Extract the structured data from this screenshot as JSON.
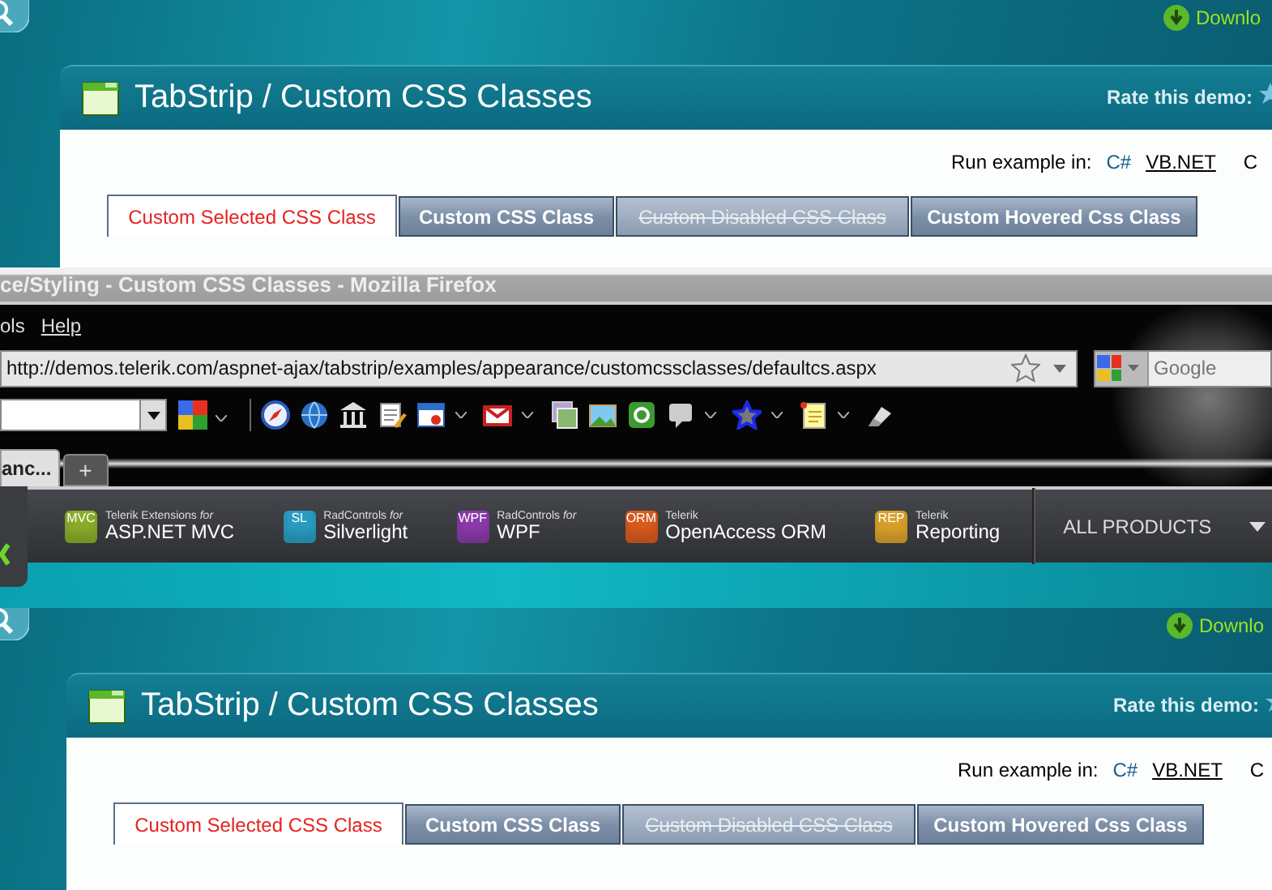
{
  "top_demo": {
    "download": "Downlo",
    "title": "TabStrip / Custom CSS Classes",
    "rate_label": "Rate this demo:",
    "run_label": "Run example in:",
    "languages": [
      {
        "label": "C#",
        "selected": true
      },
      {
        "label": "VB.NET",
        "selected": false
      }
    ],
    "edge_text": "C",
    "tabs": [
      {
        "label": "Custom Selected CSS Class",
        "selected": true,
        "disabled": false
      },
      {
        "label": "Custom CSS Class",
        "selected": false,
        "disabled": false
      },
      {
        "label": "Custom Disabled CSS Class",
        "selected": false,
        "disabled": true
      },
      {
        "label": "Custom Hovered Css Class",
        "selected": false,
        "disabled": false
      }
    ]
  },
  "firefox": {
    "title": "ce/Styling - Custom CSS Classes - Mozilla Firefox",
    "menu": [
      "ols",
      "Help"
    ],
    "url": "http://demos.telerik.com/aspnet-ajax/tabstrip/examples/appearance/customcssclasses/defaultcs.aspx",
    "search_placeholder": "Google",
    "tab_label": "anc...",
    "new_tab": "+"
  },
  "product_bar": {
    "items": [
      {
        "badge": "MVC",
        "tagline": "Telerik Extensions *for*",
        "name": "ASP.NET MVC",
        "color": "#8aac2a"
      },
      {
        "badge": "SL",
        "tagline": "RadControls *for*",
        "name": "Silverlight",
        "color": "#2a9cc0"
      },
      {
        "badge": "WPF",
        "tagline": "RadControls *for*",
        "name": "WPF",
        "color": "#8a3aa8"
      },
      {
        "badge": "ORM",
        "tagline": "Telerik",
        "name": "OpenAccess ORM",
        "color": "#d85a1e"
      },
      {
        "badge": "REP",
        "tagline": "Telerik",
        "name": "Reporting",
        "color": "#d8a02a"
      }
    ],
    "all_products": "ALL PRODUCTS"
  },
  "bottom_demo": {
    "download": "Downlo",
    "title": "TabStrip / Custom CSS Classes",
    "rate_label": "Rate this demo:",
    "run_label": "Run example in:",
    "languages": [
      {
        "label": "C#",
        "selected": true
      },
      {
        "label": "VB.NET",
        "selected": false
      }
    ],
    "edge_text": "C",
    "tabs": [
      {
        "label": "Custom Selected CSS Class",
        "selected": true,
        "disabled": false
      },
      {
        "label": "Custom CSS Class",
        "selected": false,
        "disabled": false
      },
      {
        "label": "Custom Disabled CSS Class",
        "selected": false,
        "disabled": true
      },
      {
        "label": "Custom Hovered Css Class",
        "selected": false,
        "disabled": false
      }
    ]
  }
}
